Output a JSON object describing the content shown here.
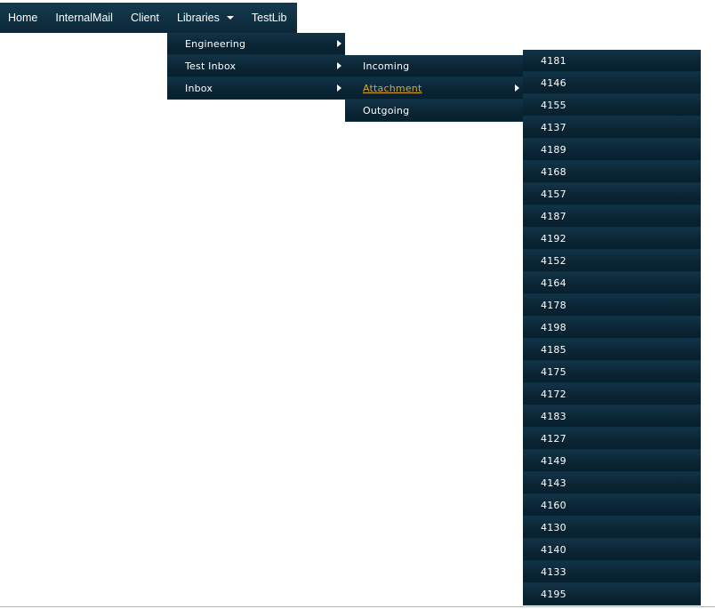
{
  "nav": {
    "items": [
      {
        "label": "Home"
      },
      {
        "label": "InternalMail"
      },
      {
        "label": "Client"
      },
      {
        "label": "Libraries",
        "icon": "caret-down-icon"
      },
      {
        "label": "TestLib"
      }
    ]
  },
  "menus": {
    "libraries": [
      {
        "label": "Engineering",
        "has_submenu": true
      },
      {
        "label": "Test Inbox",
        "has_submenu": true
      },
      {
        "label": "Inbox",
        "has_submenu": true
      }
    ],
    "test_inbox": [
      {
        "label": "Incoming",
        "has_submenu": false
      },
      {
        "label": "Attachment",
        "has_submenu": true,
        "highlighted": true
      },
      {
        "label": "Outgoing",
        "has_submenu": false
      }
    ],
    "attachment": [
      {
        "label": "4181"
      },
      {
        "label": "4146"
      },
      {
        "label": "4155"
      },
      {
        "label": "4137"
      },
      {
        "label": "4189"
      },
      {
        "label": "4168"
      },
      {
        "label": "4157"
      },
      {
        "label": "4187"
      },
      {
        "label": "4192"
      },
      {
        "label": "4152"
      },
      {
        "label": "4164"
      },
      {
        "label": "4178"
      },
      {
        "label": "4198"
      },
      {
        "label": "4185"
      },
      {
        "label": "4175"
      },
      {
        "label": "4172"
      },
      {
        "label": "4183"
      },
      {
        "label": "4127"
      },
      {
        "label": "4149"
      },
      {
        "label": "4143"
      },
      {
        "label": "4160"
      },
      {
        "label": "4130"
      },
      {
        "label": "4140"
      },
      {
        "label": "4133"
      },
      {
        "label": "4195"
      }
    ]
  },
  "colors": {
    "menu_bg": "#0b2535",
    "highlight": "#d9a72f",
    "text": "#ffffff"
  }
}
